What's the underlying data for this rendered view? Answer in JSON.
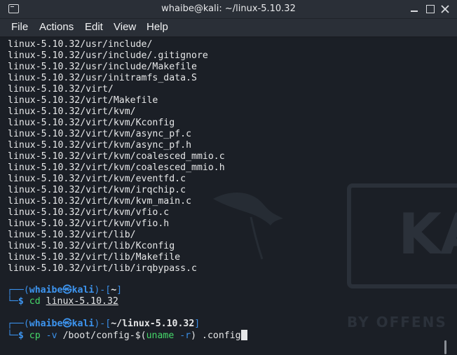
{
  "window": {
    "title": "whaibe@kali: ~/linux-5.10.32"
  },
  "menu": {
    "items": [
      "File",
      "Actions",
      "Edit",
      "View",
      "Help"
    ]
  },
  "watermark": {
    "logo": "KA",
    "tagline": "BY OFFENS"
  },
  "output": [
    "linux-5.10.32/usr/include/",
    "linux-5.10.32/usr/include/.gitignore",
    "linux-5.10.32/usr/include/Makefile",
    "linux-5.10.32/usr/initramfs_data.S",
    "linux-5.10.32/virt/",
    "linux-5.10.32/virt/Makefile",
    "linux-5.10.32/virt/kvm/",
    "linux-5.10.32/virt/kvm/Kconfig",
    "linux-5.10.32/virt/kvm/async_pf.c",
    "linux-5.10.32/virt/kvm/async_pf.h",
    "linux-5.10.32/virt/kvm/coalesced_mmio.c",
    "linux-5.10.32/virt/kvm/coalesced_mmio.h",
    "linux-5.10.32/virt/kvm/eventfd.c",
    "linux-5.10.32/virt/kvm/irqchip.c",
    "linux-5.10.32/virt/kvm/kvm_main.c",
    "linux-5.10.32/virt/kvm/vfio.c",
    "linux-5.10.32/virt/kvm/vfio.h",
    "linux-5.10.32/virt/lib/",
    "linux-5.10.32/virt/lib/Kconfig",
    "linux-5.10.32/virt/lib/Makefile",
    "linux-5.10.32/virt/lib/irqbypass.c"
  ],
  "prompt1": {
    "user": "whaibe",
    "host": "kali",
    "dir": "~",
    "cmd": "cd",
    "arg": "linux-5.10.32"
  },
  "prompt2": {
    "user": "whaibe",
    "host": "kali",
    "dir": "~/linux-5.10.32",
    "cmd": "cp",
    "opt": "-v",
    "arg_a": "/boot/config-",
    "subst_open": "$(",
    "subst_cmd": "uname",
    "subst_opt": "-r",
    "subst_close": ")",
    "arg_b": ".config"
  },
  "colors": {
    "background": "#1b1f26",
    "prompt": "#3a8fe8",
    "command": "#46d86a"
  }
}
